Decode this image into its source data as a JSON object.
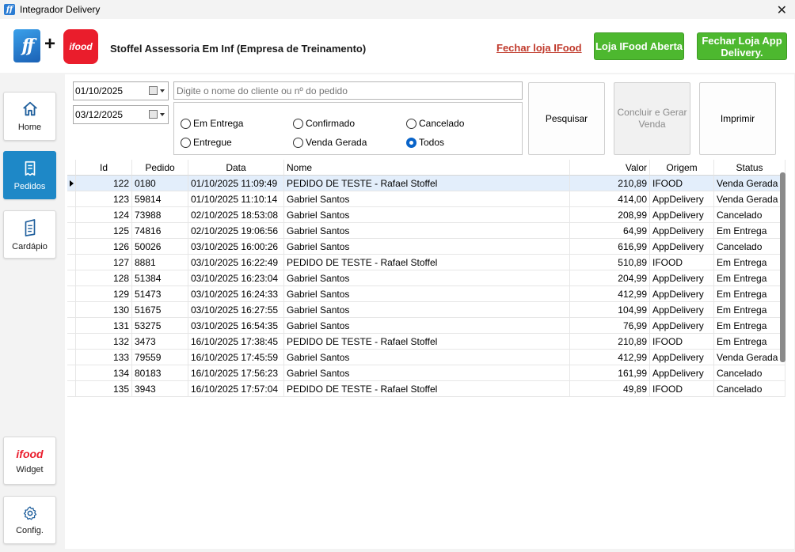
{
  "window": {
    "title": "Integrador Delivery",
    "app_icon_text": "ff",
    "close_symbol": "✕"
  },
  "header": {
    "ff_logo_text": "ff",
    "plus": "+",
    "ifood_logo_text": "ifood",
    "company": "Stoffel Assessoria Em Inf (Empresa de Treinamento)",
    "close_ifood_link": "Fechar loja IFood",
    "store_open_button": "Loja IFood Aberta",
    "close_app_button": "Fechar Loja App Delivery."
  },
  "sidebar": {
    "home": "Home",
    "pedidos": "Pedidos",
    "cardapio": "Cardápio",
    "widget_logo": "ifood",
    "widget": "Widget",
    "config": "Config."
  },
  "filters": {
    "date_from": "01/10/2025",
    "date_to": "03/12/2025",
    "search_placeholder": "Digite o nome do cliente ou nº do pedido",
    "radios": {
      "em_entrega": "Em Entrega",
      "confirmado": "Confirmado",
      "cancelado": "Cancelado",
      "entregue": "Entregue",
      "venda_gerada": "Venda Gerada",
      "todos": "Todos"
    },
    "selected": "Todos"
  },
  "actions": {
    "pesquisar": "Pesquisar",
    "concluir": "Concluir e Gerar Venda",
    "imprimir": "Imprimir"
  },
  "table": {
    "headers": {
      "id": "Id",
      "pedido": "Pedido",
      "data": "Data",
      "nome": "Nome",
      "valor": "Valor",
      "origem": "Origem",
      "status": "Status"
    },
    "rows": [
      {
        "id": "122",
        "pedido": "0180",
        "data": "01/10/2025 11:09:49",
        "nome": "PEDIDO DE TESTE - Rafael Stoffel",
        "valor": "210,89",
        "origem": "IFOOD",
        "status": "Venda Gerada"
      },
      {
        "id": "123",
        "pedido": "59814",
        "data": "01/10/2025 11:10:14",
        "nome": "Gabriel Santos",
        "valor": "414,00",
        "origem": "AppDelivery",
        "status": "Venda Gerada"
      },
      {
        "id": "124",
        "pedido": "73988",
        "data": "02/10/2025 18:53:08",
        "nome": "Gabriel Santos",
        "valor": "208,99",
        "origem": "AppDelivery",
        "status": "Cancelado"
      },
      {
        "id": "125",
        "pedido": "74816",
        "data": "02/10/2025 19:06:56",
        "nome": "Gabriel Santos",
        "valor": "64,99",
        "origem": "AppDelivery",
        "status": "Em Entrega"
      },
      {
        "id": "126",
        "pedido": "50026",
        "data": "03/10/2025 16:00:26",
        "nome": "Gabriel Santos",
        "valor": "616,99",
        "origem": "AppDelivery",
        "status": "Cancelado"
      },
      {
        "id": "127",
        "pedido": "8881",
        "data": "03/10/2025 16:22:49",
        "nome": "PEDIDO DE TESTE - Rafael Stoffel",
        "valor": "510,89",
        "origem": "IFOOD",
        "status": "Em Entrega"
      },
      {
        "id": "128",
        "pedido": "51384",
        "data": "03/10/2025 16:23:04",
        "nome": "Gabriel Santos",
        "valor": "204,99",
        "origem": "AppDelivery",
        "status": "Em Entrega"
      },
      {
        "id": "129",
        "pedido": "51473",
        "data": "03/10/2025 16:24:33",
        "nome": "Gabriel Santos",
        "valor": "412,99",
        "origem": "AppDelivery",
        "status": "Em Entrega"
      },
      {
        "id": "130",
        "pedido": "51675",
        "data": "03/10/2025 16:27:55",
        "nome": "Gabriel Santos",
        "valor": "104,99",
        "origem": "AppDelivery",
        "status": "Em Entrega"
      },
      {
        "id": "131",
        "pedido": "53275",
        "data": "03/10/2025 16:54:35",
        "nome": "Gabriel Santos",
        "valor": "76,99",
        "origem": "AppDelivery",
        "status": "Em Entrega"
      },
      {
        "id": "132",
        "pedido": "3473",
        "data": "16/10/2025 17:38:45",
        "nome": "PEDIDO DE TESTE - Rafael Stoffel",
        "valor": "210,89",
        "origem": "IFOOD",
        "status": "Em Entrega"
      },
      {
        "id": "133",
        "pedido": "79559",
        "data": "16/10/2025 17:45:59",
        "nome": "Gabriel Santos",
        "valor": "412,99",
        "origem": "AppDelivery",
        "status": "Venda Gerada"
      },
      {
        "id": "134",
        "pedido": "80183",
        "data": "16/10/2025 17:56:23",
        "nome": "Gabriel Santos",
        "valor": "161,99",
        "origem": "AppDelivery",
        "status": "Cancelado"
      },
      {
        "id": "135",
        "pedido": "3943",
        "data": "16/10/2025 17:57:04",
        "nome": "PEDIDO DE TESTE - Rafael Stoffel",
        "valor": "49,89",
        "origem": "IFOOD",
        "status": "Cancelado"
      }
    ],
    "selected_index": 0
  },
  "colors": {
    "accent_blue": "#1e88c7",
    "green_button": "#4db82f",
    "ifood_red": "#ea1d2c",
    "link_red": "#c0392b"
  }
}
